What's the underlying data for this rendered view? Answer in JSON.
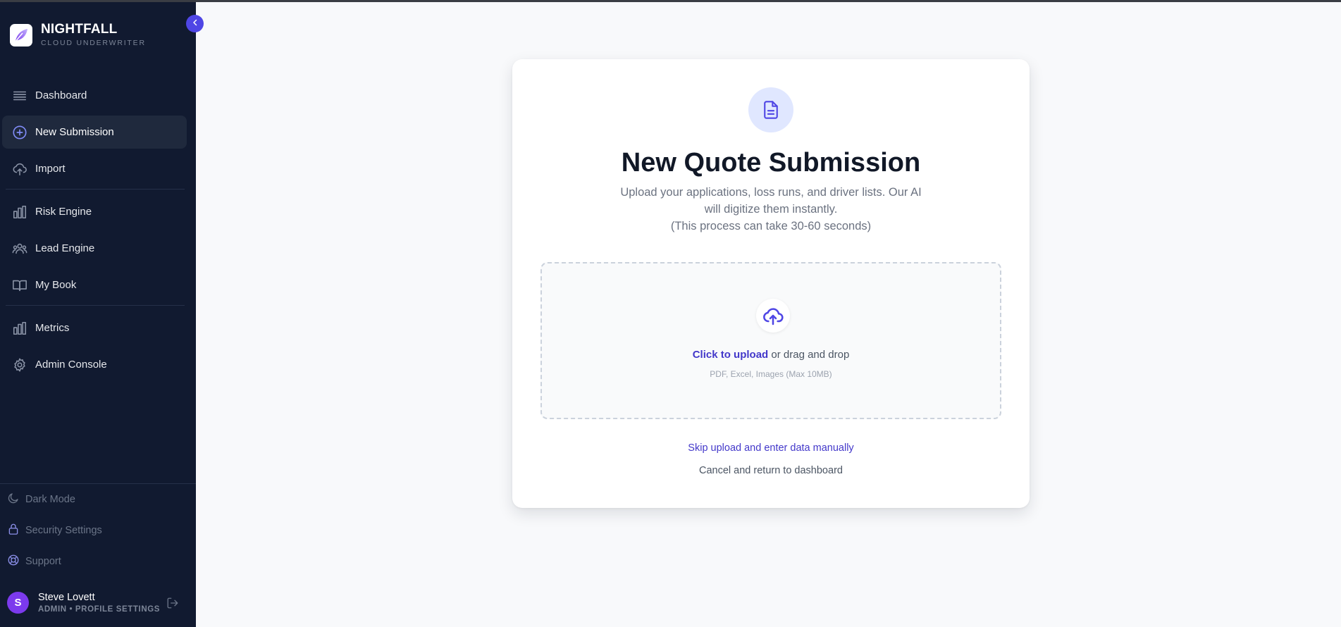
{
  "brand": {
    "name": "NIGHTFALL",
    "subtitle": "CLOUD UNDERWRITER",
    "logo_icon": "feather-logo-icon"
  },
  "sidebar": {
    "collapse_icon": "chevron-left-icon",
    "groups": [
      [
        {
          "label": "Dashboard",
          "icon": "list-icon",
          "active": false
        },
        {
          "label": "New Submission",
          "icon": "plus-circle-icon",
          "active": true
        },
        {
          "label": "Import",
          "icon": "cloud-upload-icon",
          "active": false
        }
      ],
      [
        {
          "label": "Risk Engine",
          "icon": "bar-chart-icon",
          "active": false
        },
        {
          "label": "Lead Engine",
          "icon": "users-icon",
          "active": false
        },
        {
          "label": "My Book",
          "icon": "book-icon",
          "active": false
        }
      ],
      [
        {
          "label": "Metrics",
          "icon": "bar-chart-icon",
          "active": false
        },
        {
          "label": "Admin Console",
          "icon": "gear-icon",
          "active": false
        }
      ]
    ],
    "bottom_items": [
      {
        "label": "Dark Mode",
        "icon": "moon-icon"
      },
      {
        "label": "Security Settings",
        "icon": "lock-icon"
      },
      {
        "label": "Support",
        "icon": "lifebuoy-icon"
      }
    ],
    "user": {
      "initial": "S",
      "name": "Steve Lovett",
      "role": "ADMIN • PROFILE SETTINGS",
      "logout_icon": "logout-icon"
    }
  },
  "main": {
    "title": "New Quote Submission",
    "subtitle_line1": "Upload your applications, loss runs, and driver lists. Our AI",
    "subtitle_line2": "will digitize them instantly.",
    "subtitle_line3": "(This process can take 30-60 seconds)",
    "upload": {
      "link_text": "Click to upload",
      "rest_text": " or drag and drop",
      "hint": "PDF, Excel, Images (Max 10MB)"
    },
    "skip_label": "Skip upload and enter data manually",
    "cancel_label": "Cancel and return to dashboard"
  },
  "colors": {
    "sidebar_bg": "#111a30",
    "accent": "#4f46e5",
    "link": "#4338ca",
    "avatar": "#7c3aed"
  }
}
